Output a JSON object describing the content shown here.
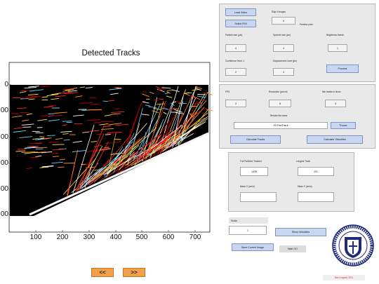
{
  "plot": {
    "title": "Detected Tracks",
    "y_ticks": [
      "0",
      "00",
      "00",
      "00",
      "00",
      "00"
    ],
    "x_ticks": [
      "100",
      "200",
      "300",
      "400",
      "500",
      "600",
      "700"
    ]
  },
  "nav": {
    "prev_label": "<<",
    "next_label": ">>"
  },
  "top_panel": {
    "load_label": "Load Video",
    "select_roi_label": "Select ROI",
    "skip_frames_label": "Skip # images",
    "skip_frames_value": "0",
    "preview_label": "Preview pixel",
    "particle_size_label": "Particle size (pix)",
    "particle_size_value": "4",
    "speckle_label": "Speckle size (pix)",
    "speckle_value": "4",
    "brightness_label": "Brightness thresh.",
    "brightness_value": "1",
    "confidence_label": "Confidence level: 1",
    "confidence_value": "2",
    "displacement_label": "Displacement Limit (pix)",
    "displacement_value": "4",
    "process_label": "Process"
  },
  "mid_panel": {
    "fps_label": "FPS",
    "fps_value": "3",
    "resolution_label": "Resolution (px/cm)",
    "resolution_value": "8",
    "min_tracks_label": "Min tracks to show",
    "min_tracks_value": "3",
    "results_label": "Results file name",
    "results_value": "Z0-FishTrack",
    "browse_label": "Trouve",
    "calc_tracks_label": "Calculate Tracks",
    "calc_velocities_label": "Calculate Velocities"
  },
  "stats_panel": {
    "full_label": "Full Particles Tracked",
    "full_value": "1435",
    "longest_label": "Longest Track",
    "longest_value": "201",
    "mean_x_label": "Mean X (cm/s)",
    "mean_x_value": "",
    "mean_y_label": "Mean Y (cm/s)",
    "mean_y_value": ""
  },
  "bottom": {
    "scale_label": "Scale",
    "scale_value": "1",
    "show_velocities_label": "Show Velocities",
    "save_image_label": "Save Current Image",
    "status_value": "Wait GO",
    "credit": "Ken Leopold, 2011"
  },
  "colors": {
    "plot_bg": "#000000",
    "panel_bg": "#e9e9e9",
    "button_bg": "#c9d6f0",
    "nav_bg": "#f2a14a",
    "credit_red": "#d42020",
    "seal_blue": "#1f2a78",
    "track_colors": [
      "#ffffff",
      "#ffe24a",
      "#ff9a1e",
      "#ff2a1e",
      "#c00000",
      "#6ad0ff"
    ]
  }
}
